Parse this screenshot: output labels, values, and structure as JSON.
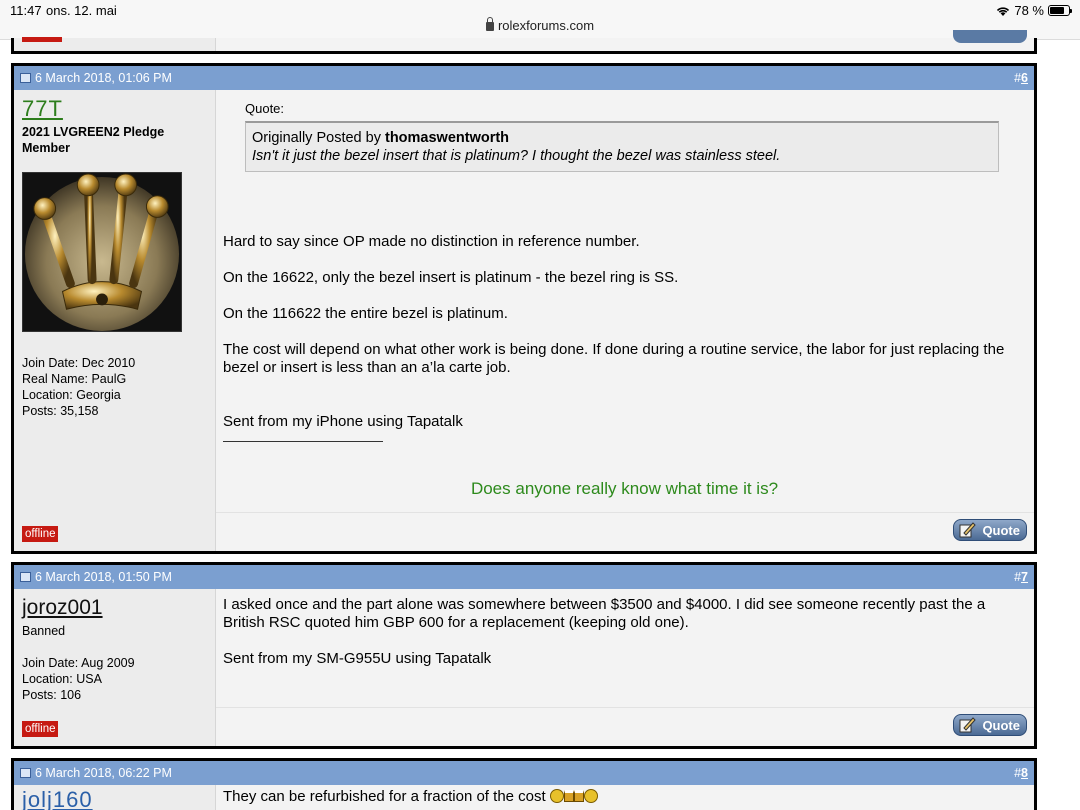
{
  "status_bar": {
    "time": "11:47",
    "date": "ons. 12. mai",
    "battery": "78 %",
    "battery_level": 0.78,
    "url": "rolexforums.com"
  },
  "posts": [
    {
      "date": "6 March 2018, 01:06 PM",
      "number": "#6",
      "username": "77T",
      "usertitle": "2021 LVGREEN2 Pledge Member",
      "join_date": "Join Date: Dec 2010",
      "real_name": "Real Name: PaulG",
      "location": "Location: Georgia",
      "posts": "Posts: 35,158",
      "status": "offline",
      "quote_label": "Quote:",
      "quote_author_prefix": "Originally Posted by",
      "quote_author": "thomaswentworth",
      "quote_text": "Isn't it just the bezel insert that is platinum? I thought the bezel was stainless steel.",
      "paragraphs": [
        "Hard to say since OP made no distinction in reference number.",
        "On the 16622, only the bezel insert is platinum - the bezel ring is SS.",
        "On the 116622 the entire bezel is platinum.",
        "The cost will depend on what other work is being done. If done during a routine service, the labor for just replacing the bezel or insert is less than an a’la carte job.",
        "Sent from my iPhone using Tapatalk"
      ],
      "signature": "Does anyone really know what time it is?",
      "quote_button": "Quote"
    },
    {
      "date": "6 March 2018, 01:50 PM",
      "number": "#7",
      "username": "joroz001",
      "usertitle": "Banned",
      "join_date": "Join Date: Aug 2009",
      "location": "Location: USA",
      "posts": "Posts: 106",
      "status": "offline",
      "paragraphs": [
        "I asked once and the part alone was somewhere between $3500 and $4000. I did see someone recently past the a British RSC quoted him GBP 600 for a replacement (keeping old one).",
        "Sent from my SM-G955U using Tapatalk"
      ],
      "quote_button": "Quote"
    },
    {
      "date": "6 March 2018, 06:22 PM",
      "number": "#8",
      "username": "jolj160",
      "paragraphs": [
        "They can be refurbished for a fraction of the cost"
      ]
    }
  ],
  "icons": [
    "wifi-icon",
    "battery-icon",
    "lock-icon",
    "post-icon",
    "quote-pen-icon",
    "smiley-icon",
    "beer-icon"
  ]
}
